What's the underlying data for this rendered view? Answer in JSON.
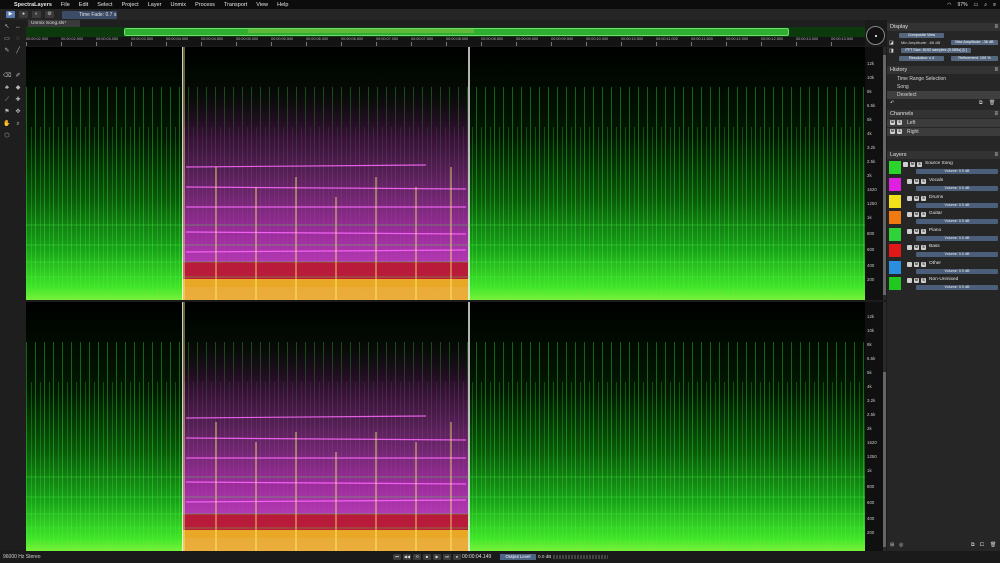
{
  "menubar": {
    "app": "SpectraLayers",
    "items": [
      "File",
      "Edit",
      "Select",
      "Project",
      "Layer",
      "Unmix",
      "Process",
      "Transport",
      "View",
      "Help"
    ],
    "battery": "97%"
  },
  "toolbar": {
    "fade_label": "Time Fade: 0.7 s"
  },
  "tabs": [
    {
      "label": "Unmix Song.sls*"
    }
  ],
  "ruler": {
    "ticks": [
      "00:00:02.000",
      "00:00:02.500",
      "00:00:03.000",
      "00:00:03.500",
      "00:00:04.000",
      "00:00:04.500",
      "00:00:05.000",
      "00:00:05.500",
      "00:00:06.000",
      "00:00:06.500",
      "00:00:07.000",
      "00:00:07.500",
      "00:00:08.000",
      "00:00:08.500",
      "00:00:09.000",
      "00:00:09.500",
      "00:00:10.000",
      "00:00:10.500",
      "00:00:11.000",
      "00:00:11.500",
      "00:00:12.000",
      "00:00:12.500",
      "00:00:13.000",
      "00:00:13.500"
    ]
  },
  "freq_scale": {
    "top": [
      "12k",
      "10k",
      "8k",
      "6.5k",
      "5k",
      "4k",
      "3.2k",
      "2.5k",
      "2k",
      "1620",
      "1250",
      "1k",
      "800",
      "600",
      "400",
      "200"
    ],
    "bottom": [
      "12k",
      "10k",
      "8k",
      "6.5k",
      "5k",
      "4k",
      "3.2k",
      "2.5k",
      "2k",
      "1620",
      "1250",
      "1k",
      "800",
      "600",
      "400",
      "200"
    ]
  },
  "panel": {
    "display": {
      "title": "Display",
      "composite": "Composite View",
      "min_amp": "Min Amplitude: -66 dB",
      "max_amp": "Max Amplitude: -36 dB",
      "fft": "FFT Size: 8192 samples (0.085s) [L]",
      "reso_left": "Resolution: x 4",
      "reso_right": "Refinement: 100 %"
    },
    "history": {
      "title": "History",
      "items": [
        "Time Range Selection",
        "Song",
        "Deselect"
      ]
    },
    "channels": {
      "title": "Channels",
      "items": [
        "Left",
        "Right"
      ]
    },
    "layers": {
      "title": "Layers",
      "items": [
        {
          "name": "Source Song",
          "color": "#2bd42b",
          "volume": "Volume: 0.0 dB"
        },
        {
          "name": "Vocals",
          "color": "#e020e0",
          "volume": "Volume: 0.0 dB"
        },
        {
          "name": "Drums",
          "color": "#f2e21a",
          "volume": "Volume: 0.0 dB"
        },
        {
          "name": "Guitar",
          "color": "#f07a10",
          "volume": "Volume: 0.0 dB"
        },
        {
          "name": "Piano",
          "color": "#30d23a",
          "volume": "Volume: 0.0 dB"
        },
        {
          "name": "Bass",
          "color": "#e01818",
          "volume": "Volume: 0.0 dB"
        },
        {
          "name": "Other",
          "color": "#2a8fe0",
          "volume": "Volume: 0.0 dB"
        },
        {
          "name": "Non-Unmixed",
          "color": "#20c820",
          "volume": "Volume: 0.0 dB"
        }
      ]
    }
  },
  "status": {
    "format": "96000 Hz Stereo",
    "position": "00:00:04.149",
    "output_label": "Output Level",
    "output_value": "0.0 dB"
  }
}
